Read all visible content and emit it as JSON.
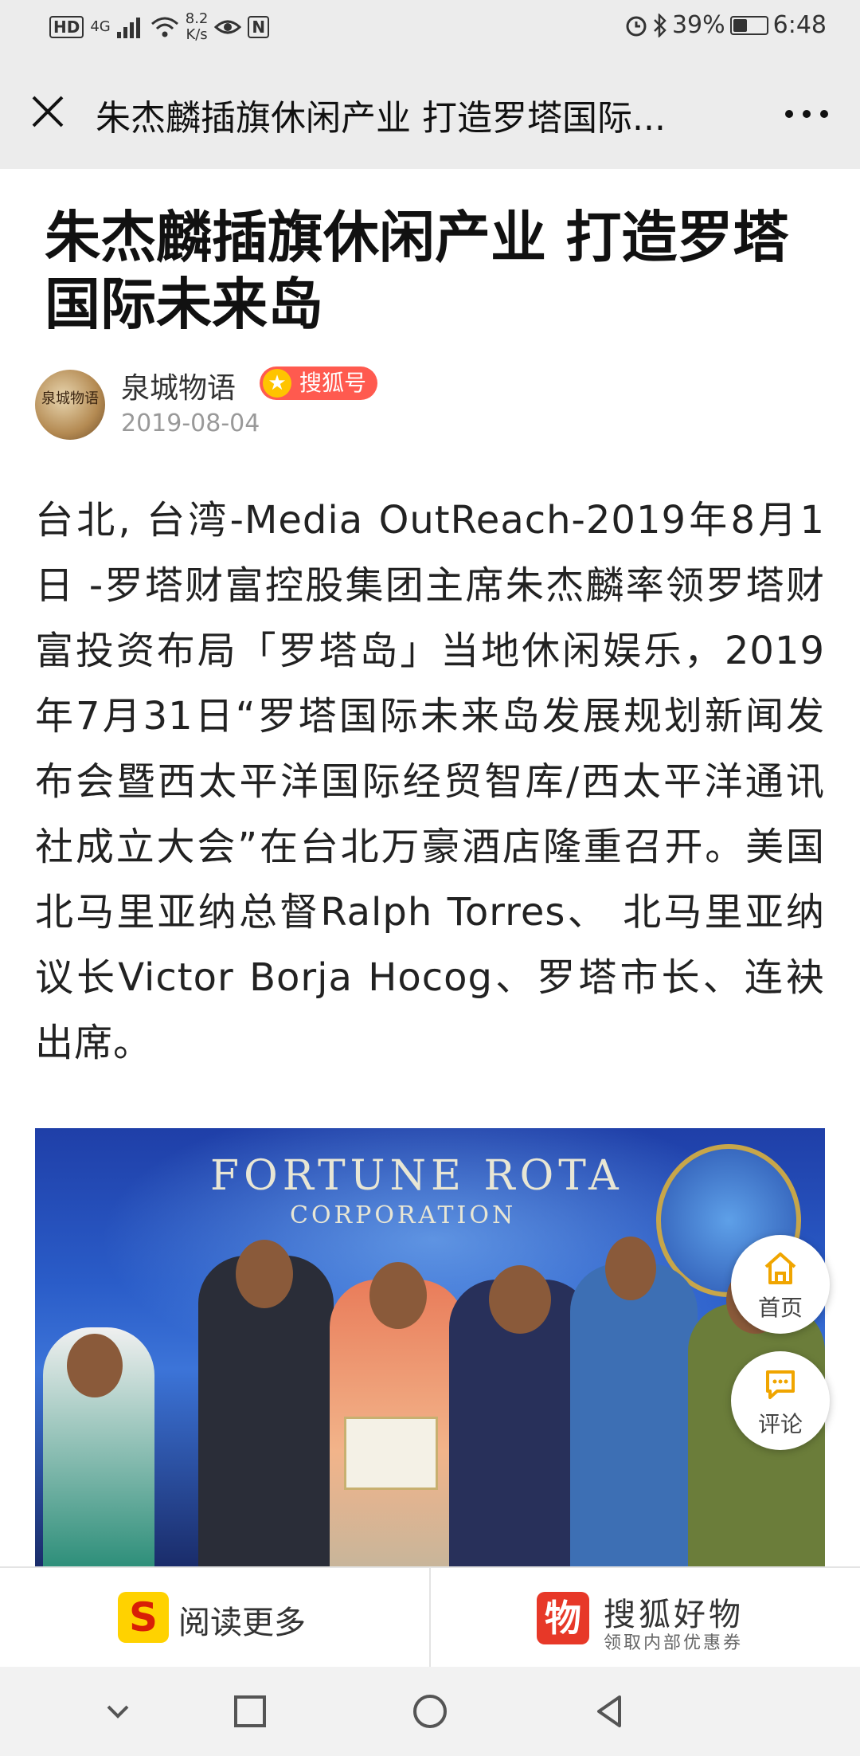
{
  "status_bar": {
    "hd": "HD",
    "network": "4G",
    "speed_value": "8.2",
    "speed_unit": "K/s",
    "nfc": "N",
    "battery": "39%",
    "battery_level": 0.39,
    "time": "6:48"
  },
  "nav": {
    "title": "朱杰麟插旗休闲产业 打造罗塔国际..."
  },
  "article": {
    "headline": "朱杰麟插旗休闲产业 打造罗塔国际未来岛",
    "author": "泉城物语",
    "badge": "搜狐号",
    "date": "2019-08-04",
    "avatar_text": "泉城物语",
    "body": "台北, 台湾-Media OutReach-2019年8月1日 -罗塔财富控股集团主席朱杰麟率领罗塔财富投资布局「罗塔岛」当地休闲娱乐，2019年7月31日“罗塔国际未来岛发展规划新闻发布会暨西太平洋国际经贸智库/西太平洋通讯社成立大会”在台北万豪酒店隆重召开。美国北马里亚纳总督Ralph Torres、 北马里亚纳议长Victor Borja Hocog、罗塔市长、连袂出席。"
  },
  "photo": {
    "banner_line1": "FORTUNE ROTA",
    "banner_line2": "CORPORATION"
  },
  "floating": {
    "home_label": "首页",
    "comment_label": "评论"
  },
  "action_bar": {
    "read_more_icon": "S",
    "read_more_label": "阅读更多",
    "shop_icon": "物",
    "shop_title": "搜狐好物",
    "shop_subtitle": "领取内部优惠券"
  },
  "colors": {
    "badge": "#ff5a4f",
    "read_more_icon_bg": "#ffd200",
    "shop_icon_bg": "#e73828"
  }
}
